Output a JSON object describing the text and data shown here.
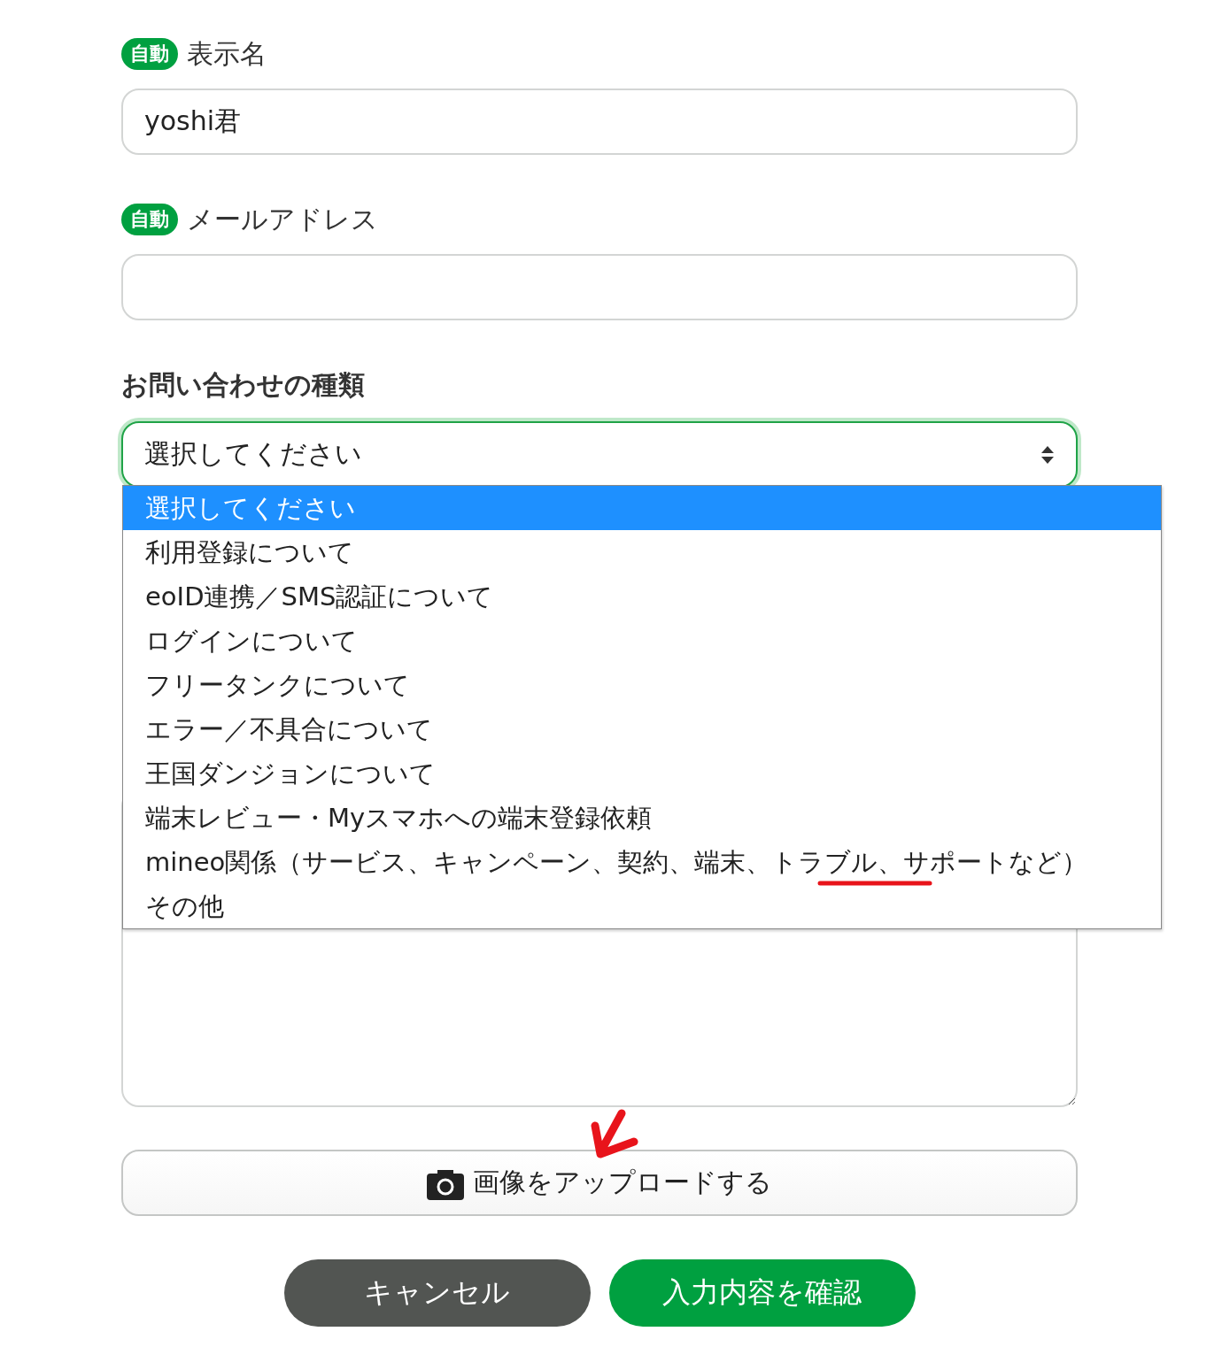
{
  "fields": [
    {
      "badge": "自動",
      "label": "表示名",
      "value": "yoshi君"
    },
    {
      "badge": "自動",
      "label": "メールアドレス"
    }
  ],
  "inquiry_type": {
    "label": "お問い合わせの種類",
    "select": {
      "value": "選択してください",
      "expanded": true,
      "options": [
        {
          "label": "選択してください",
          "selected": true
        },
        {
          "label": "利用登録について",
          "selected": false
        },
        {
          "label": "eoID連携／SMS認証について",
          "selected": false
        },
        {
          "label": "ログインについて",
          "selected": false
        },
        {
          "label": "フリータンクについて",
          "selected": false
        },
        {
          "label": "エラー／不具合について",
          "selected": false
        },
        {
          "label": "王国ダンジョンについて",
          "selected": false
        },
        {
          "label": "端末レビュー・Myスマホへの端末登録依頼",
          "selected": false
        },
        {
          "label": "mineo関係（サービス、キャンペーン、契約、端末、トラブル、サポートなど）",
          "selected": false
        },
        {
          "label": "その他",
          "selected": false
        }
      ]
    }
  },
  "upload_button": {
    "label": "画像をアップロードする"
  },
  "buttons": [
    {
      "label": "キャンセル",
      "kind": "secondary"
    },
    {
      "label": "入力内容を確認",
      "kind": "primary"
    }
  ],
  "annotations": {
    "underline": true,
    "arrow": true
  }
}
